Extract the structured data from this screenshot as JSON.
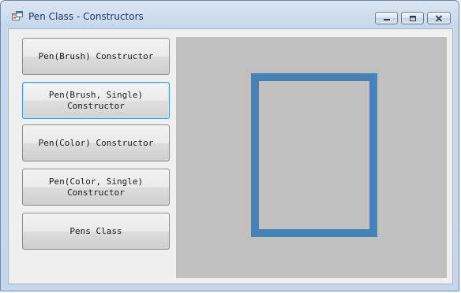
{
  "window": {
    "title": "Pen Class - Constructors",
    "app_icon": "windows-form-icon",
    "controls": {
      "minimize_icon": "minimize-icon",
      "maximize_icon": "maximize-icon",
      "close_icon": "close-icon"
    }
  },
  "sidebar": {
    "buttons": [
      {
        "label": "Pen(Brush) Constructor"
      },
      {
        "label": "Pen(Brush, Single)\nConstructor"
      },
      {
        "label": "Pen(Color) Constructor"
      },
      {
        "label": "Pen(Color, Single)\nConstructor"
      },
      {
        "label": "Pens Class"
      }
    ],
    "focused_index": 1
  },
  "canvas": {
    "background_color": "#c0c0c0",
    "shape": {
      "type": "rectangle-outline",
      "stroke_color": "#4682b4"
    }
  },
  "colors": {
    "focus_border": "#3c9fdc",
    "title_text": "#1e395b"
  }
}
